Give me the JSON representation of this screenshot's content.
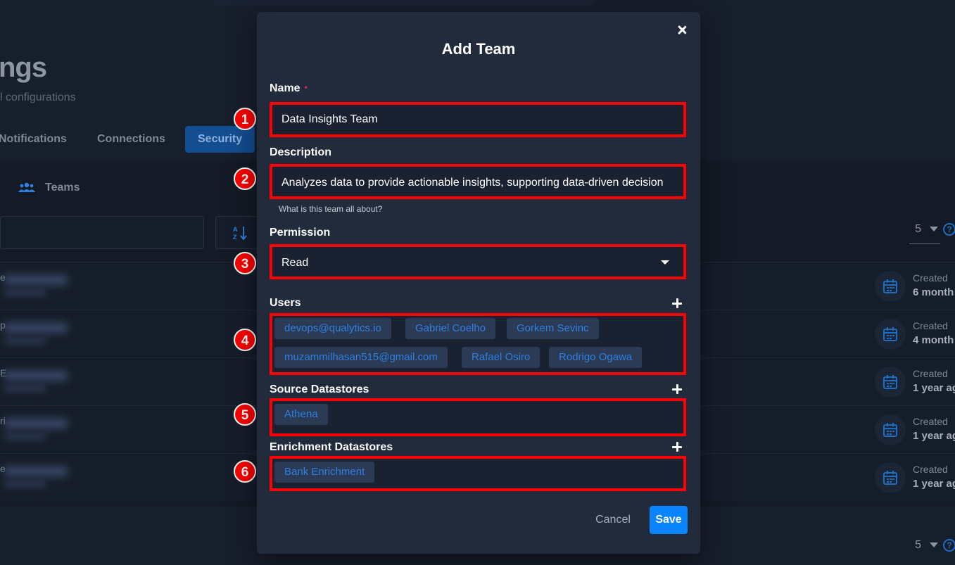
{
  "background": {
    "page_title": "ngs",
    "page_subtitle": "l configurations",
    "tabs": [
      {
        "label": "Notifications"
      },
      {
        "label": "Connections"
      },
      {
        "label": "Security"
      }
    ],
    "teams_label": "Teams",
    "pager_value": "5",
    "help": "?",
    "rows": [
      {
        "letter": "e",
        "created_label": "Created",
        "created_when": "6 month"
      },
      {
        "letter": "p",
        "created_label": "Created",
        "created_when": "4 month"
      },
      {
        "letter": "E",
        "created_label": "Created",
        "created_when": "1 year ag"
      },
      {
        "letter": "ri",
        "created_label": "Created",
        "created_when": "1 year ag"
      },
      {
        "letter": "e",
        "created_label": "Created",
        "created_when": "1 year ag"
      }
    ]
  },
  "modal": {
    "title": "Add Team",
    "name": {
      "label": "Name",
      "required_mark": "•",
      "value": "Data Insights Team"
    },
    "description": {
      "label": "Description",
      "value": "Analyzes data to provide actionable insights, supporting data-driven decision",
      "hint": "What is this team all about?"
    },
    "permission": {
      "label": "Permission",
      "value": "Read"
    },
    "users": {
      "label": "Users",
      "items": [
        "devops@qualytics.io",
        "Gabriel Coelho",
        "Gorkem Sevinc",
        "muzammilhasan515@gmail.com",
        "Rafael Osiro",
        "Rodrigo Ogawa"
      ]
    },
    "source_datastores": {
      "label": "Source Datastores",
      "items": [
        "Athena"
      ]
    },
    "enrichment_datastores": {
      "label": "Enrichment Datastores",
      "items": [
        "Bank Enrichment"
      ]
    },
    "cancel_label": "Cancel",
    "save_label": "Save"
  },
  "annotations": [
    "1",
    "2",
    "3",
    "4",
    "5",
    "6"
  ],
  "colors": {
    "accent": "#0a84ff",
    "highlight": "#ff0000",
    "modal_bg": "#222b3c",
    "chip_text": "#2f7fe0"
  }
}
